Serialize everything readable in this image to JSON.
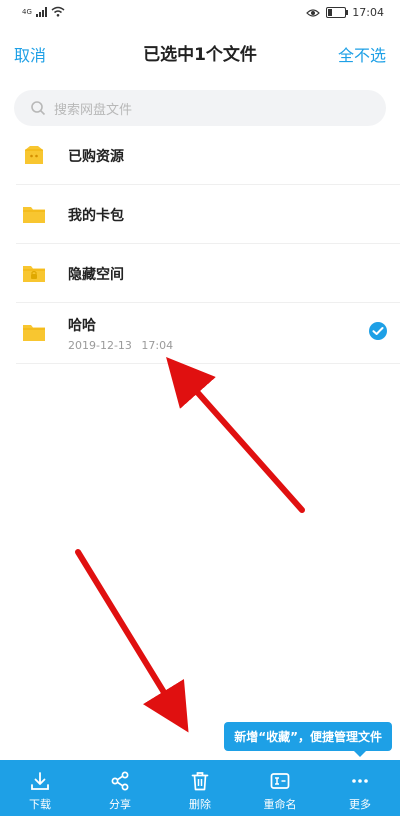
{
  "status_bar": {
    "network": "4G",
    "time": "17:04"
  },
  "header": {
    "cancel_label": "取消",
    "title": "已选中1个文件",
    "deselect_all_label": "全不选"
  },
  "search": {
    "placeholder": "搜索网盘文件"
  },
  "files": [
    {
      "name": "已购资源",
      "icon": "purchased-folder-icon",
      "meta": "",
      "selected": false
    },
    {
      "name": "我的卡包",
      "icon": "folder-icon",
      "meta": "",
      "selected": false
    },
    {
      "name": "隐藏空间",
      "icon": "locked-folder-icon",
      "meta": "",
      "selected": false
    },
    {
      "name": "哈哈",
      "icon": "folder-icon",
      "meta": "2019-12-13 17:04",
      "selected": true
    }
  ],
  "tooltip": {
    "text": "新增“收藏”，便捷管理文件"
  },
  "toolbar": {
    "items": [
      {
        "label": "下载",
        "icon": "download-icon"
      },
      {
        "label": "分享",
        "icon": "share-icon"
      },
      {
        "label": "删除",
        "icon": "trash-icon"
      },
      {
        "label": "重命名",
        "icon": "rename-icon"
      },
      {
        "label": "更多",
        "icon": "more-icon"
      }
    ]
  },
  "colors": {
    "accent": "#1ea0e6",
    "folder": "#f8c630",
    "arrow": "#e01010"
  }
}
